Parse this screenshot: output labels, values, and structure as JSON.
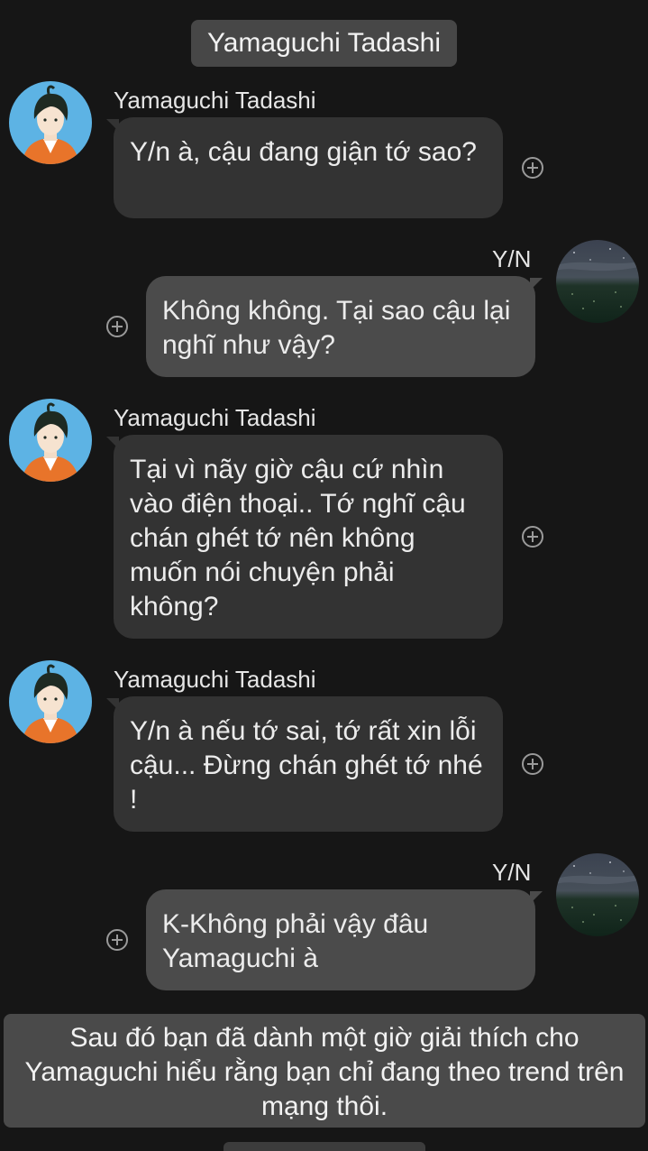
{
  "header": {
    "title": "Yamaguchi Tadashi"
  },
  "messages": [
    {
      "sender": "Yamaguchi Tadashi",
      "text": "Y/n à, cậu đang giận tớ sao?",
      "side": "left"
    },
    {
      "sender": "Y/N",
      "text": "Không không. Tại sao cậu lại nghĩ như vậy?",
      "side": "right"
    },
    {
      "sender": "Yamaguchi Tadashi",
      "text": "Tại vì nãy giờ cậu cứ nhìn vào điện thoại.. Tớ nghĩ cậu chán ghét tớ nên không muốn nói chuyện phải không?",
      "side": "left"
    },
    {
      "sender": "Yamaguchi Tadashi",
      "text": "Y/n à nếu tớ sai, tớ rất xin lỗi cậu... Đừng chán ghét tớ nhé !",
      "side": "left"
    },
    {
      "sender": "Y/N",
      "text": "K-Không phải vậy đâu Yamaguchi à",
      "side": "right"
    }
  ],
  "narration": "Sau đó bạn đã dành một giờ giải thích cho Yamaguchi hiểu rằng bạn chỉ đang theo trend trên mạng thôi.",
  "icons": {
    "react": "plus-circle-icon",
    "avatar_yamaguchi": "anime-boy-avatar-icon",
    "avatar_yn": "night-sky-field-avatar-icon"
  },
  "colors": {
    "background": "#161616",
    "incoming_bubble": "#333333",
    "outgoing_bubble": "#4b4b4b",
    "title_pill": "#474747"
  }
}
